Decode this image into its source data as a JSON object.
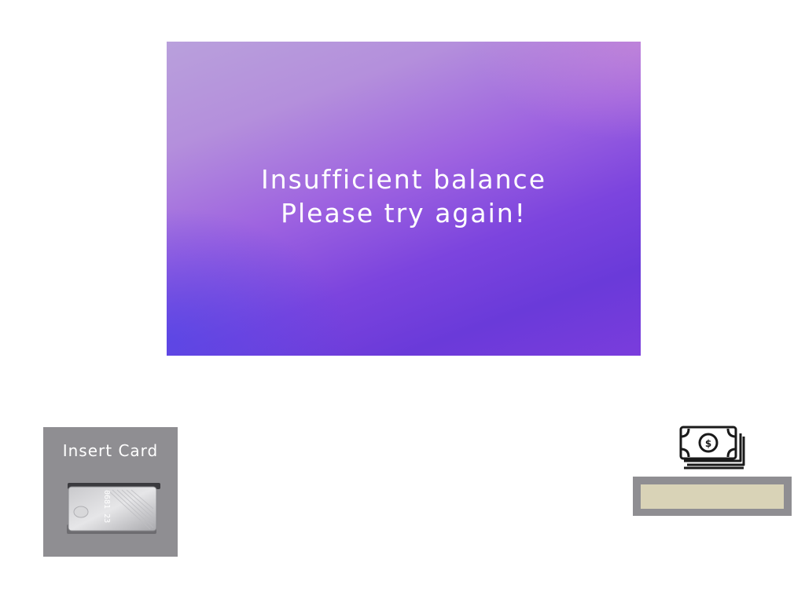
{
  "screen": {
    "message_line1": "Insufficient balance",
    "message_line2": "Please try again!"
  },
  "card_slot": {
    "label": "Insert Card",
    "icon": "credit-card-in-slot-icon",
    "card_number_fragment": "0681 23"
  },
  "cash": {
    "icon": "banknotes-stack-icon",
    "currency_symbol": "$"
  },
  "colors": {
    "screen_gradient_top": "#b9a0dc",
    "screen_gradient_bottom": "#6a3ad9",
    "panel_gray": "#8f8e92",
    "cash_tray": "#d9d3b7",
    "text_white": "#ffffff"
  }
}
